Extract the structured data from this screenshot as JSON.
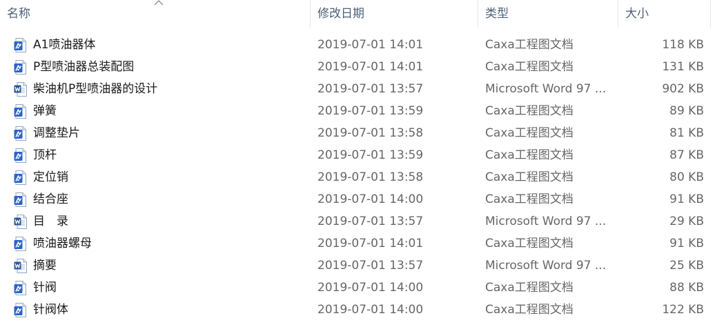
{
  "columns": {
    "name": "名称",
    "date": "修改日期",
    "type": "类型",
    "size": "大小"
  },
  "icons": {
    "caxa": "caxa-drawing-icon",
    "word": "word-document-icon",
    "sort": "sort-ascending-icon"
  },
  "colors": {
    "header_text": "#4c607a",
    "name_text": "#1a1a1a",
    "meta_text": "#666666",
    "caxa_blue": "#2a64c8",
    "word_blue": "#2b579a"
  },
  "files": [
    {
      "name": "A1喷油器体",
      "date": "2019-07-01 14:01",
      "type": "Caxa工程图文档",
      "size": "118 KB",
      "icon": "caxa"
    },
    {
      "name": "P型喷油器总装配图",
      "date": "2019-07-01 14:01",
      "type": "Caxa工程图文档",
      "size": "131 KB",
      "icon": "caxa"
    },
    {
      "name": "柴油机P型喷油器的设计",
      "date": "2019-07-01 13:57",
      "type": "Microsoft Word 97 ...",
      "size": "902 KB",
      "icon": "word"
    },
    {
      "name": "弹簧",
      "date": "2019-07-01 13:59",
      "type": "Caxa工程图文档",
      "size": "89 KB",
      "icon": "caxa"
    },
    {
      "name": "调整垫片",
      "date": "2019-07-01 13:58",
      "type": "Caxa工程图文档",
      "size": "81 KB",
      "icon": "caxa"
    },
    {
      "name": "顶杆",
      "date": "2019-07-01 13:59",
      "type": "Caxa工程图文档",
      "size": "87 KB",
      "icon": "caxa"
    },
    {
      "name": "定位销",
      "date": "2019-07-01 13:58",
      "type": "Caxa工程图文档",
      "size": "80 KB",
      "icon": "caxa"
    },
    {
      "name": "结合座",
      "date": "2019-07-01 14:00",
      "type": "Caxa工程图文档",
      "size": "91 KB",
      "icon": "caxa"
    },
    {
      "name": "目　录",
      "date": "2019-07-01 13:57",
      "type": "Microsoft Word 97 ...",
      "size": "29 KB",
      "icon": "word"
    },
    {
      "name": "喷油器螺母",
      "date": "2019-07-01 14:01",
      "type": "Caxa工程图文档",
      "size": "91 KB",
      "icon": "caxa"
    },
    {
      "name": "摘要",
      "date": "2019-07-01 13:57",
      "type": "Microsoft Word 97 ...",
      "size": "25 KB",
      "icon": "word"
    },
    {
      "name": "针阀",
      "date": "2019-07-01 14:00",
      "type": "Caxa工程图文档",
      "size": "88 KB",
      "icon": "caxa"
    },
    {
      "name": "针阀体",
      "date": "2019-07-01 14:00",
      "type": "Caxa工程图文档",
      "size": "122 KB",
      "icon": "caxa"
    }
  ]
}
